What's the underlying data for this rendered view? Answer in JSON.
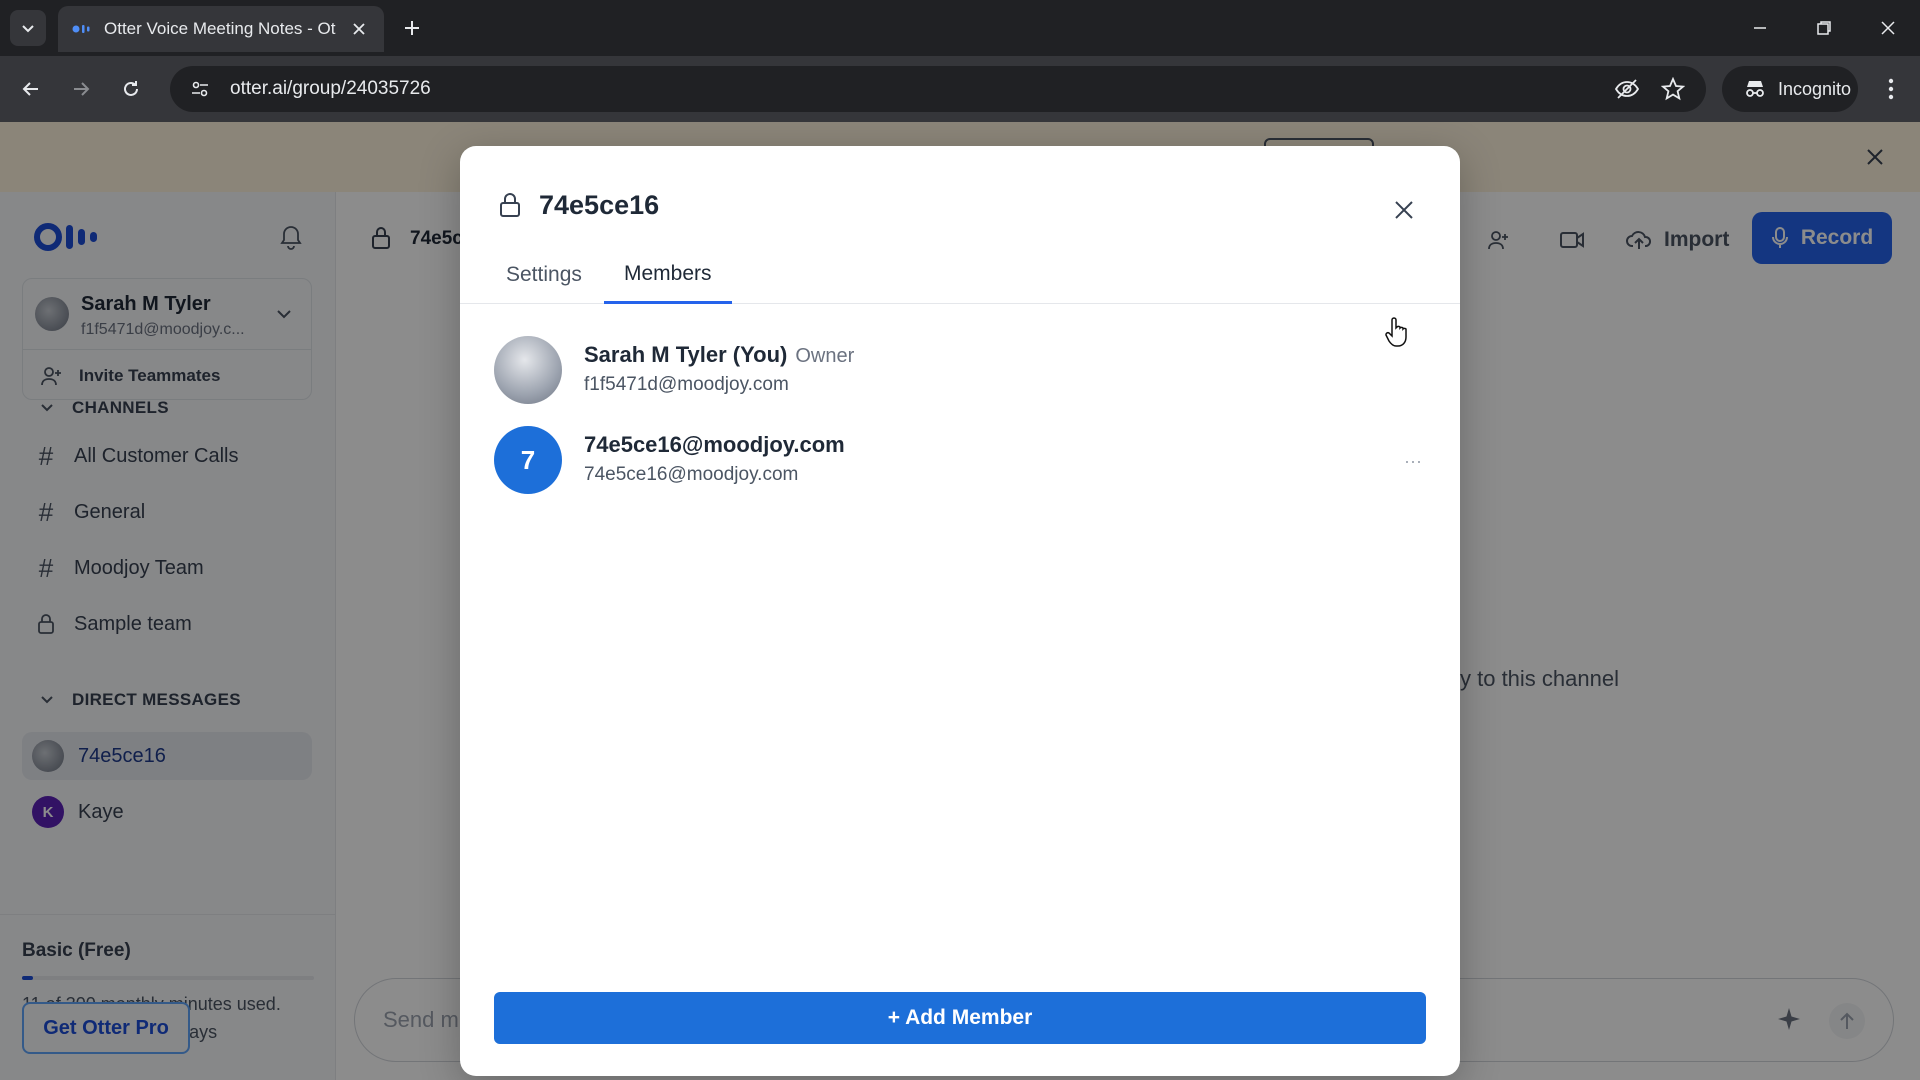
{
  "browser": {
    "tab_title": "Otter Voice Meeting Notes - Ot",
    "url": "otter.ai/group/24035726",
    "incognito_label": "Incognito"
  },
  "sidebar": {
    "user": {
      "name": "Sarah M Tyler",
      "email": "f1f5471d@moodjoy.c..."
    },
    "invite_label": "Invite Teammates",
    "channels_heading": "CHANNELS",
    "channels": [
      {
        "label": "All Customer Calls",
        "icon": "#"
      },
      {
        "label": "General",
        "icon": "#"
      },
      {
        "label": "Moodjoy Team",
        "icon": "#"
      },
      {
        "label": "Sample team",
        "icon": "lock"
      }
    ],
    "dm_heading": "DIRECT MESSAGES",
    "direct_messages": [
      {
        "label": "74e5ce16",
        "initial": "",
        "color": "#6b7280"
      },
      {
        "label": "Kaye",
        "initial": "K",
        "color": "#5b21b6"
      }
    ],
    "plan": {
      "name": "Basic (Free)",
      "usage_line1": "11 of 300 monthly minutes used.",
      "usage_line2": "Minutes reset in 26 days",
      "usage_fraction": 0.037,
      "cta": "Get Otter Pro"
    }
  },
  "main": {
    "channel_title": "74e5c",
    "import_label": "Import",
    "record_label": "Record",
    "hint": "y to this channel",
    "composer_placeholder": "Send m"
  },
  "modal": {
    "title": "74e5ce16",
    "tabs": [
      {
        "label": "Settings",
        "active": false
      },
      {
        "label": "Members",
        "active": true
      }
    ],
    "members": [
      {
        "name": "Sarah M Tyler (You)",
        "role": "Owner",
        "email": "f1f5471d@moodjoy.com",
        "initial": "",
        "color": "#9ca3af"
      },
      {
        "name": "74e5ce16@moodjoy.com",
        "role": "",
        "email": "74e5ce16@moodjoy.com",
        "initial": "7",
        "color": "#1d6fd9"
      }
    ],
    "add_member_label": "+ Add Member"
  },
  "colors": {
    "accent": "#2563eb",
    "banner": "#fdf3dc"
  }
}
